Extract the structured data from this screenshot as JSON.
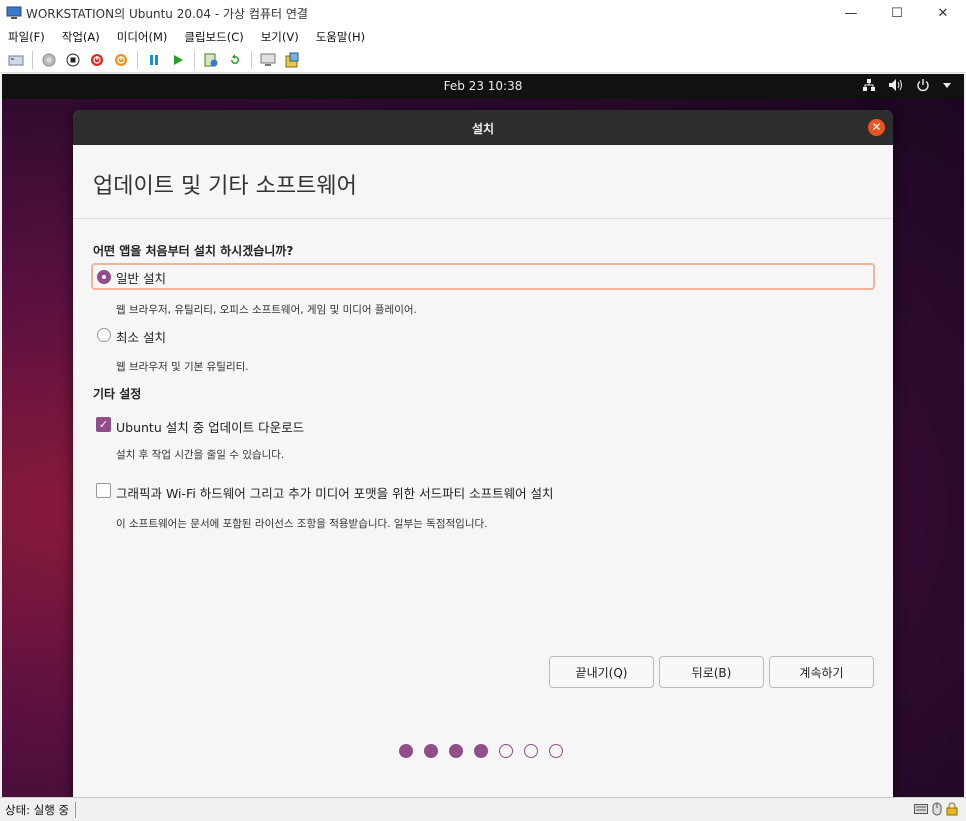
{
  "window": {
    "title": "WORKSTATION의 Ubuntu 20.04 - 가상 컴퓨터 연결",
    "minimize": "—",
    "maximize": "☐",
    "close": "✕"
  },
  "menu": [
    "파일(F)",
    "작업(A)",
    "미디어(M)",
    "클립보드(C)",
    "보기(V)",
    "도움말(H)"
  ],
  "toolbar_icons": [
    "ctrl-alt-del-icon",
    "start-icon",
    "turn-off-icon",
    "shut-down-icon",
    "save-icon",
    "pause-icon",
    "resume-icon",
    "checkpoint-icon",
    "revert-icon",
    "enhanced-session-icon",
    "share-icon"
  ],
  "vm": {
    "clock": "Feb 23  10:38",
    "installer": {
      "title": "설치",
      "page_title": "업데이트 및 기타 소프트웨어",
      "question": "어떤 앱을 처음부터 설치 하시겠습니까?",
      "options": [
        {
          "label": "일반 설치",
          "desc": "웹 브라우저, 유틸리티, 오피스  소프트웨어, 게임 및 미디어 플레이어.",
          "selected": true
        },
        {
          "label": "최소 설치",
          "desc": "웹 브라우저 및 기본 유틸리티.",
          "selected": false
        }
      ],
      "other_section": "기타 설정",
      "checks": [
        {
          "label": "Ubuntu 설치 중 업데이트 다운로드",
          "desc": "설치 후 작업 시간을 줄일 수 있습니다.",
          "checked": true
        },
        {
          "label": "그래픽과 Wi-Fi 하드웨어 그리고 추가 미디어 포맷을 위한 서드파티 소프트웨어 설치",
          "desc": "이 소프트웨어는 문서에 포함된 라이선스 조항을 적용받습니다. 일부는 독점적입니다.",
          "checked": false
        }
      ],
      "buttons": {
        "quit": "끝내기(Q)",
        "back": "뒤로(B)",
        "continue": "계속하기"
      },
      "progress": {
        "current": 4,
        "total": 7
      }
    }
  },
  "status": {
    "text": "상태: 실행 중"
  },
  "colors": {
    "accent": "#924d8b",
    "close": "#e95420",
    "focus": "#f0b49a"
  }
}
